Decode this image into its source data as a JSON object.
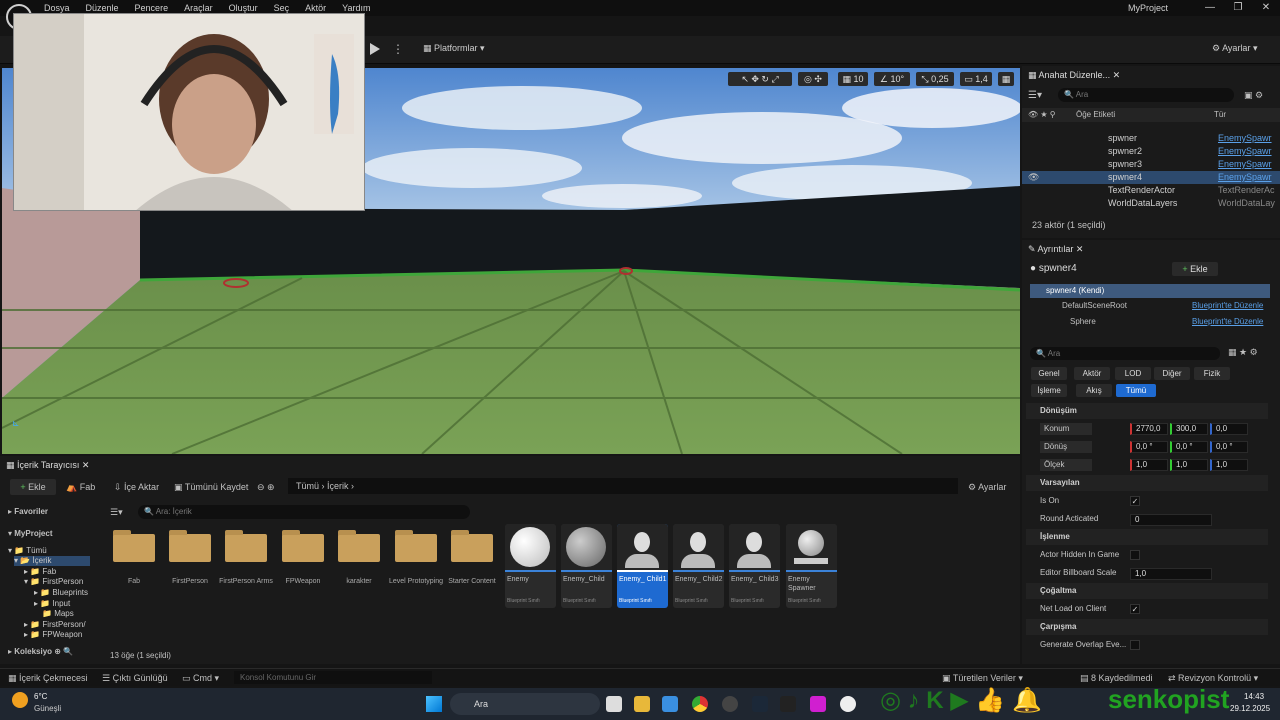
{
  "window": {
    "menus": [
      "Dosya",
      "Düzenle",
      "Pencere",
      "Araçlar",
      "Oluştur",
      "Seç",
      "Aktör",
      "Yardım"
    ],
    "project_name": "MyProject",
    "minimize": "—",
    "maximize": "❐",
    "close": "✕"
  },
  "toolbar": {
    "platforms_label": "Platformlar",
    "settings_label": "Ayarlar"
  },
  "viewport": {
    "grid_size": "10",
    "rotation_snap": "10°",
    "scale_snap": "0,25",
    "camera_speed": "1,4"
  },
  "outliner": {
    "tab_label": "Anahat Düzenle...",
    "search_placeholder": "Ara",
    "col_label": "Öğe Etiketi",
    "col_type": "Tür",
    "rows": [
      {
        "name": "spwner",
        "type": "EnemySpawr"
      },
      {
        "name": "spwner2",
        "type": "EnemySpawr"
      },
      {
        "name": "spwner3",
        "type": "EnemySpawr"
      },
      {
        "name": "spwner4",
        "type": "EnemySpawr"
      },
      {
        "name": "TextRenderActor",
        "type": "TextRenderAc"
      },
      {
        "name": "WorldDataLayers",
        "type": "WorldDataLay"
      }
    ],
    "status": "23 aktör (1 seçildi)"
  },
  "details": {
    "tab_label": "Ayrıntılar",
    "actor_name": "spwner4",
    "add_label": "Ekle",
    "self_label": "spwner4 (Kendi)",
    "components": [
      {
        "name": "DefaultSceneRoot",
        "link": "Blueprint'te Düzenle"
      },
      {
        "name": "Sphere",
        "link": "Blueprint'te Düzenle"
      }
    ],
    "search_placeholder": "Ara",
    "filters_row1": [
      "Genel",
      "Aktör",
      "LOD",
      "Diğer",
      "Fizik"
    ],
    "filters_row2": [
      "İşleme",
      "Akış",
      "Tümü"
    ],
    "transform_title": "Dönüşüm",
    "location_label": "Konum",
    "location": [
      "2770,0",
      "300,0",
      "0,0"
    ],
    "rotation_label": "Dönüş",
    "rotation": [
      "0,0 °",
      "0,0 °",
      "0,0 °"
    ],
    "scale_label": "Ölçek",
    "scale": [
      "1,0",
      "1,0",
      "1,0"
    ],
    "defaults_title": "Varsayılan",
    "is_on_label": "Is On",
    "round_label": "Round Acticated",
    "round_value": "0",
    "render_title": "İşlenme",
    "hidden_label": "Actor Hidden In Game",
    "billboard_label": "Editor Billboard Scale",
    "billboard_value": "1,0",
    "repl_title": "Çoğaltma",
    "net_label": "Net Load on Client",
    "collision_title": "Çarpışma",
    "overlap_label": "Generate Overlap Eve..."
  },
  "content_browser": {
    "tab_label": "İçerik Tarayıcısı",
    "add_label": "Ekle",
    "fab_label": "Fab",
    "import_label": "İçe Aktar",
    "save_all_label": "Tümünü Kaydet",
    "path": [
      "Tümü",
      "İçerik"
    ],
    "settings_label": "Ayarlar",
    "favorites_label": "Favoriler",
    "myproject_label": "MyProject",
    "collections_label": "Koleksiyo",
    "tree": [
      "Tümü",
      "İçerik",
      "Fab",
      "FirstPerson",
      "Blueprints",
      "Input",
      "Maps",
      "FirstPerson/",
      "FPWeapon"
    ],
    "search_placeholder": "Ara: İçerik",
    "folders": [
      "Fab",
      "FirstPerson",
      "FirstPerson Arms",
      "FPWeapon",
      "karakter",
      "Level Prototyping",
      "Starter Content"
    ],
    "assets": [
      {
        "name": "Enemy",
        "class": "Blueprint Sınıfı"
      },
      {
        "name": "Enemy_Child",
        "class": "Blueprint Sınıfı"
      },
      {
        "name": "Enemy_ Child1",
        "class": "Blueprint Sınıfı"
      },
      {
        "name": "Enemy_ Child2",
        "class": "Blueprint Sınıfı"
      },
      {
        "name": "Enemy_ Child3",
        "class": "Blueprint Sınıfı"
      },
      {
        "name": "Enemy Spawner",
        "class": "Blueprint Sınıfı"
      }
    ],
    "count": "13 öğe (1 seçildi)"
  },
  "statusbar": {
    "drawer": "İçerik Çekmecesi",
    "output_log": "Çıktı Günlüğü",
    "cmd": "Cmd",
    "console_placeholder": "Konsol Komutunu Gir",
    "derived": "Türetilen Veriler",
    "unsaved": "8 Kaydedilmedi",
    "revision": "Revizyon Kontrolü"
  },
  "taskbar": {
    "weather_temp": "6°C",
    "weather_desc": "Güneşli",
    "search": "Ara",
    "channel": "senkopist",
    "time": "14:43",
    "date": "29.12.2025"
  }
}
